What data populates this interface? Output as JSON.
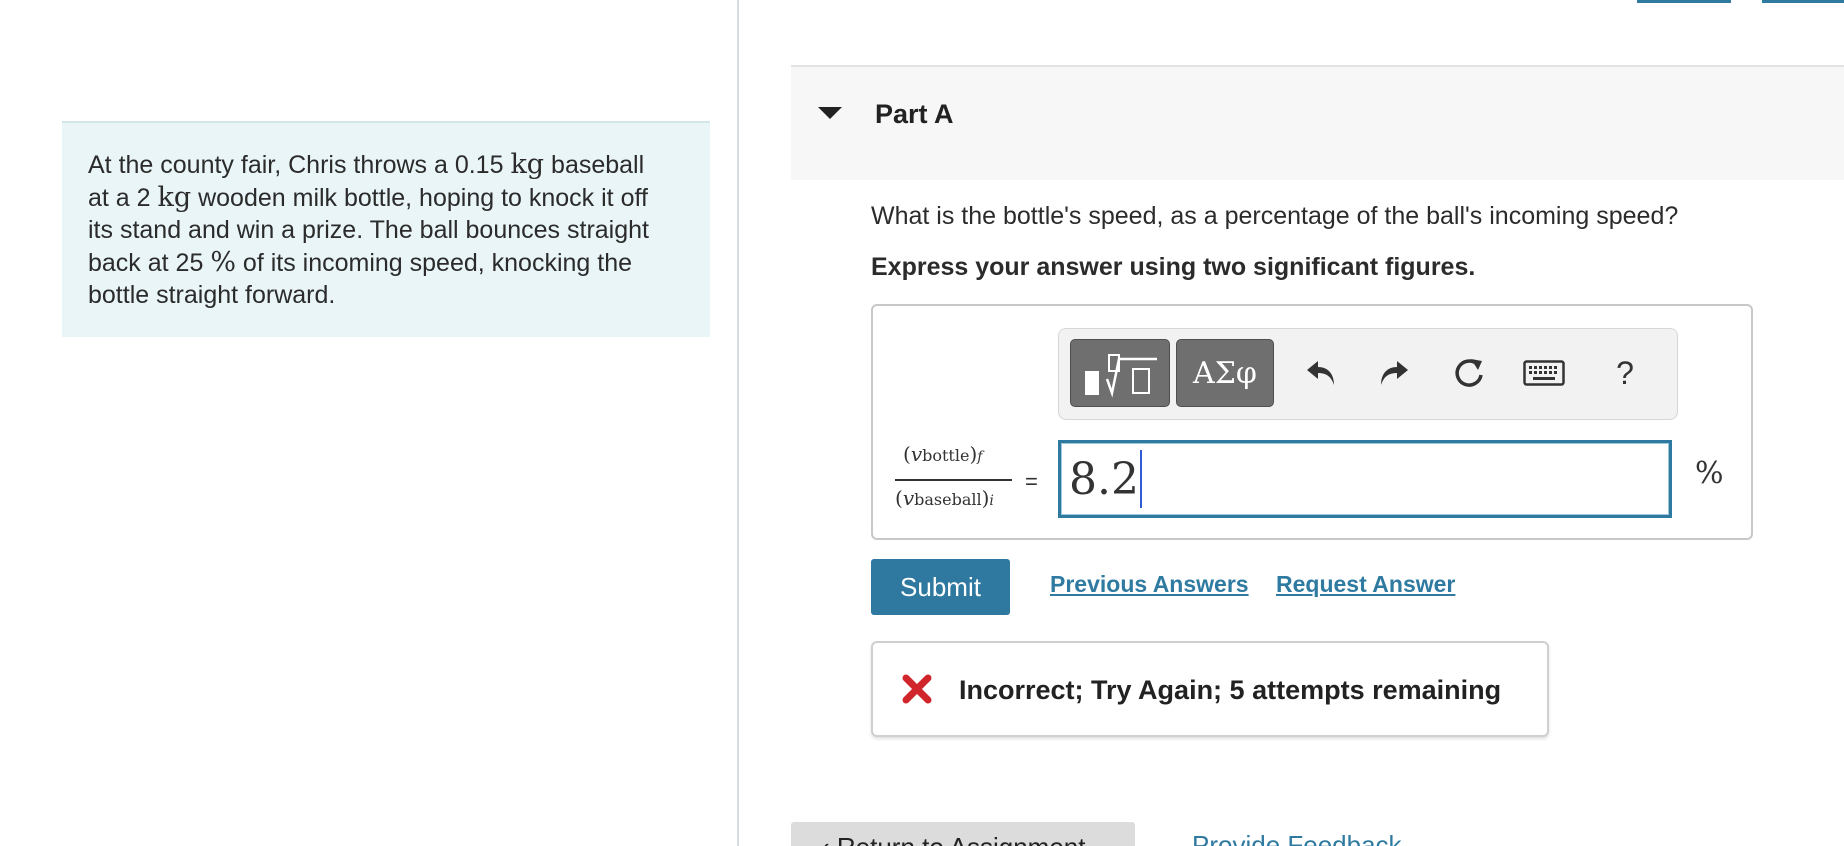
{
  "problem": {
    "line1_pre": "At the county fair, Chris throws a 0.15 ",
    "unit_kg": "kg",
    "line1_post": " baseball",
    "line2_pre": "at a 2 ",
    "line2_post": " wooden milk bottle, hoping to knock it off",
    "line3": "its stand and win a prize. The ball bounces straight",
    "line4_pre": "back at 25 ",
    "percent_symbol": "%",
    "line4_post": " of its incoming speed, knocking the",
    "line5": "bottle straight forward."
  },
  "part": {
    "title": "Part A",
    "question": "What is the bottle's speed, as a percentage of the ball's incoming speed?",
    "instruction": "Express your answer using two significant figures."
  },
  "toolbar": {
    "greek_label": "ΑΣφ",
    "help_label": "?"
  },
  "equation": {
    "numerator_var": "v",
    "numerator_sub": "bottle",
    "numerator_outer_sub": "f",
    "denominator_var": "v",
    "denominator_sub": "baseball",
    "denominator_outer_sub": "i",
    "equals": "=",
    "answer_value": "8.2",
    "unit": "%"
  },
  "actions": {
    "submit": "Submit",
    "previous_answers": "Previous Answers",
    "request_answer": "Request Answer"
  },
  "feedback": {
    "message": "Incorrect; Try Again; 5 attempts remaining",
    "status_color": "#d0262b"
  },
  "footer": {
    "return": "Return to Assignment",
    "provide_feedback": "Provide Feedback"
  },
  "colors": {
    "accent": "#2e7aa1",
    "problem_bg": "#e9f5f7"
  }
}
